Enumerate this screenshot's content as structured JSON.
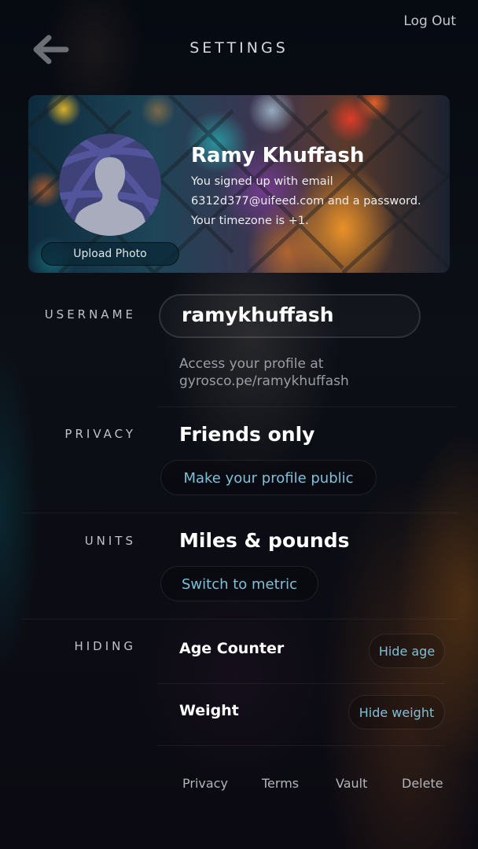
{
  "header": {
    "title": "SETTINGS",
    "logout_label": "Log Out"
  },
  "profile": {
    "name": "Ramy Khuffash",
    "signup_text": "You signed up with email 6312d377@uifeed.com and a password. Your timezone is +1.",
    "upload_label": "Upload Photo"
  },
  "username": {
    "label": "USERNAME",
    "value": "ramykhuffash",
    "hint": "Access your profile at gyrosco.pe/ramykhuffash"
  },
  "privacy": {
    "label": "PRIVACY",
    "value": "Friends only",
    "action": "Make your profile public"
  },
  "units": {
    "label": "UNITS",
    "value": "Miles & pounds",
    "action": "Switch to metric"
  },
  "hiding": {
    "label": "HIDING",
    "items": [
      {
        "label": "Age Counter",
        "action": "Hide age"
      },
      {
        "label": "Weight",
        "action": "Hide weight"
      }
    ]
  },
  "footer": {
    "links": [
      "Privacy",
      "Terms",
      "Vault",
      "Delete"
    ]
  },
  "colors": {
    "accent": "#7ec0d8",
    "background": "#070b12"
  }
}
